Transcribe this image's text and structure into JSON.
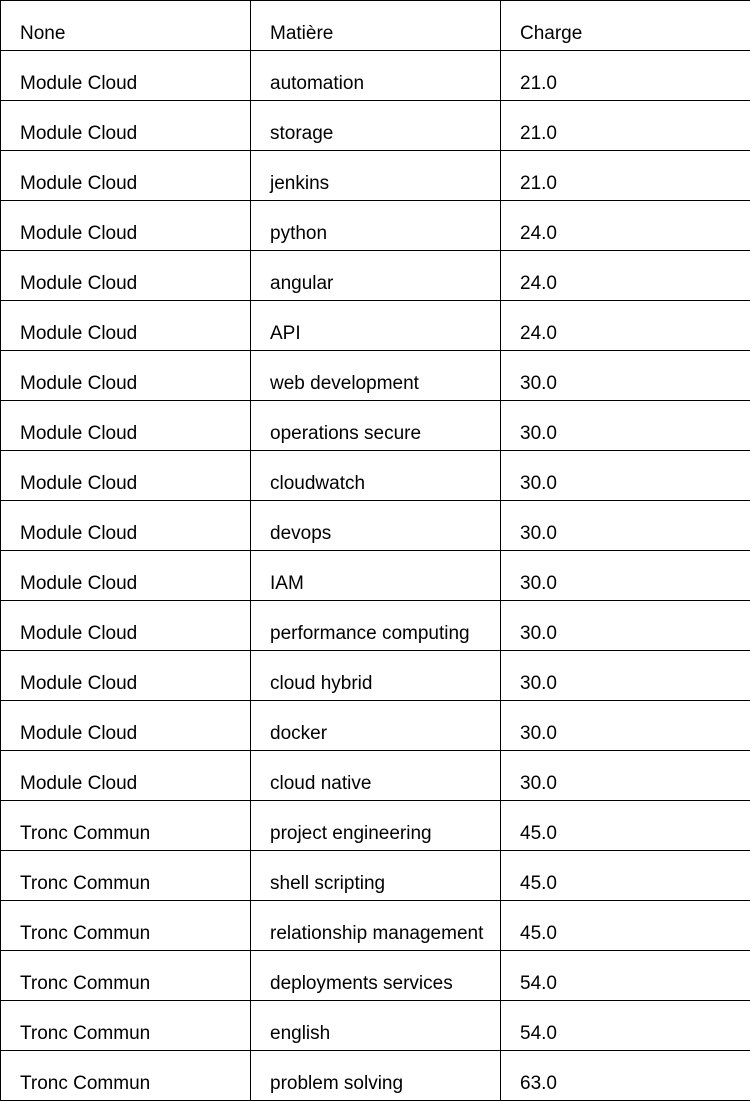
{
  "table": {
    "headers": [
      "None",
      "Matière",
      "Charge"
    ],
    "rows": [
      [
        "Module Cloud",
        "automation",
        "21.0"
      ],
      [
        "Module Cloud",
        "storage",
        "21.0"
      ],
      [
        "Module Cloud",
        "jenkins",
        "21.0"
      ],
      [
        "Module Cloud",
        "python",
        "24.0"
      ],
      [
        "Module Cloud",
        "angular",
        "24.0"
      ],
      [
        "Module Cloud",
        "API",
        "24.0"
      ],
      [
        "Module Cloud",
        "web development",
        "30.0"
      ],
      [
        "Module Cloud",
        "operations secure",
        "30.0"
      ],
      [
        "Module Cloud",
        "cloudwatch",
        "30.0"
      ],
      [
        "Module Cloud",
        "devops",
        "30.0"
      ],
      [
        "Module Cloud",
        "IAM",
        "30.0"
      ],
      [
        "Module Cloud",
        "performance computing",
        "30.0"
      ],
      [
        "Module Cloud",
        "cloud hybrid",
        "30.0"
      ],
      [
        "Module Cloud",
        "docker",
        "30.0"
      ],
      [
        "Module Cloud",
        "cloud native",
        "30.0"
      ],
      [
        "Tronc Commun",
        "project engineering",
        "45.0"
      ],
      [
        "Tronc Commun",
        "shell scripting",
        "45.0"
      ],
      [
        "Tronc Commun",
        "relationship management",
        "45.0"
      ],
      [
        "Tronc Commun",
        "deployments services",
        "54.0"
      ],
      [
        "Tronc Commun",
        "english",
        "54.0"
      ],
      [
        "Tronc Commun",
        "problem solving",
        "63.0"
      ]
    ]
  }
}
